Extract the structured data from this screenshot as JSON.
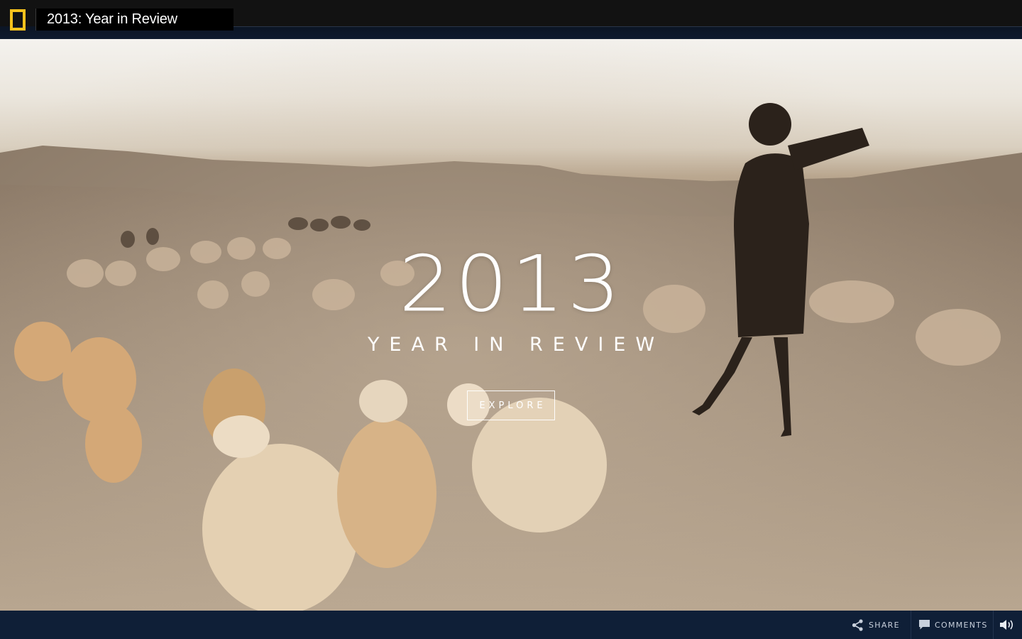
{
  "header": {
    "title": "2013: Year in Review",
    "logo_icon": "natgeo-rectangle-icon",
    "brand_color": "#f6c21c"
  },
  "hero": {
    "year": "2013",
    "subtitle": "YEAR IN REVIEW",
    "explore_label": "EXPLORE"
  },
  "footer": {
    "share_label": "SHARE",
    "comments_label": "COMMENTS",
    "share_icon": "share-icon",
    "comments_icon": "comment-bubble-icon",
    "sound_icon": "speaker-volume-icon",
    "bar_color": "#0f1f37"
  }
}
